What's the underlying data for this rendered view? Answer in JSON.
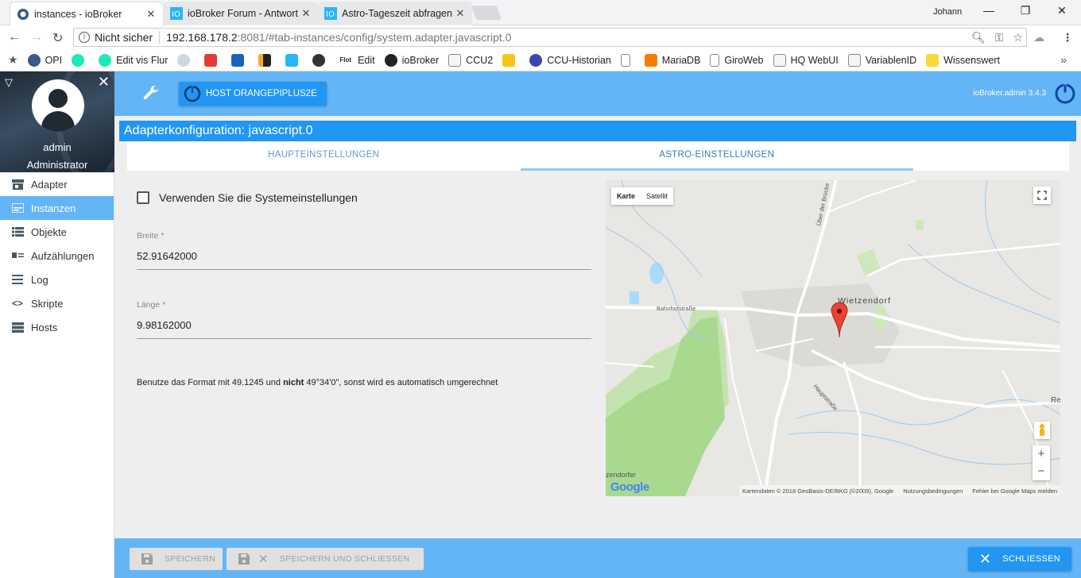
{
  "browser": {
    "tabs": [
      {
        "title": "instances - ioBroker",
        "active": true
      },
      {
        "title": "ioBroker Forum - Antwort",
        "active": false
      },
      {
        "title": "Astro-Tageszeit abfragen",
        "active": false
      }
    ],
    "profile_name": "Johann",
    "address": {
      "security": "Nicht sicher",
      "host": "192.168.178.2",
      "path": ":8081/#tab-instances/config/system.adapter.javascript.0"
    },
    "bookmarks": [
      {
        "label": "",
        "color": "#3a5a8a"
      },
      {
        "label": "OPI",
        "color": "#3a5a8a"
      },
      {
        "label": "",
        "color": "#1de9b6"
      },
      {
        "label": "Edit vis Flur",
        "color": "#1de9b6"
      },
      {
        "label": "",
        "color": "#b0bec5"
      },
      {
        "label": "",
        "color": "#e53935"
      },
      {
        "label": "",
        "color": "#1565c0"
      },
      {
        "label": "",
        "color": "#f9a825"
      },
      {
        "label": "",
        "color": "#29b6f6"
      },
      {
        "label": "",
        "color": "#333333"
      },
      {
        "label": "Edit",
        "color": "#ffffff"
      },
      {
        "label": "ioBroker",
        "color": "#222222"
      },
      {
        "label": "CCU2",
        "color": "#eeeeee"
      },
      {
        "label": "",
        "color": "#f5c518"
      },
      {
        "label": "CCU-Historian",
        "color": "#3949ab"
      },
      {
        "label": "",
        "color": "#eeeeee"
      },
      {
        "label": "MariaDB",
        "color": "#f57c00"
      },
      {
        "label": "GiroWeb",
        "color": "#eeeeee"
      },
      {
        "label": "HQ WebUI",
        "color": "#eeeeee"
      },
      {
        "label": "VariablenID",
        "color": "#eeeeee"
      },
      {
        "label": "Wissenswert",
        "color": "#fdd835"
      }
    ],
    "flot_label": "Flot"
  },
  "sidebar": {
    "user": "admin",
    "role": "Administrator",
    "items": [
      {
        "label": "Adapter",
        "icon": "store-icon",
        "active": false
      },
      {
        "label": "Instanzen",
        "icon": "instances-icon",
        "active": true
      },
      {
        "label": "Objekte",
        "icon": "list-icon",
        "active": false
      },
      {
        "label": "Aufzählungen",
        "icon": "enums-icon",
        "active": false
      },
      {
        "label": "Log",
        "icon": "log-icon",
        "active": false
      },
      {
        "label": "Skripte",
        "icon": "code-icon",
        "active": false
      },
      {
        "label": "Hosts",
        "icon": "hosts-icon",
        "active": false
      }
    ]
  },
  "appbar": {
    "host_button": "HOST ORANGEPIPLUS2E",
    "version": "ioBroker.admin 3.4.3"
  },
  "main": {
    "title": "Adapterkonfiguration: javascript.0",
    "tabs": [
      {
        "label": "HAUPTEINSTELLUNGEN",
        "selected": false
      },
      {
        "label": "ASTRO-EINSTELLUNGEN",
        "selected": true
      }
    ],
    "checkbox_label": "Verwenden Sie die Systemeinstellungen",
    "checkbox_checked": false,
    "latitude": {
      "label": "Breite *",
      "value": "52.91642000"
    },
    "longitude": {
      "label": "Länge *",
      "value": "9.98162000"
    },
    "hint": {
      "prefix": "Benutze das Format mit 49.1245 und ",
      "bold": "nicht",
      "suffix": " 49°34'0\", sonst wird es automatisch umgerechnet"
    }
  },
  "map": {
    "type_map": "Karte",
    "type_satellite": "Satellit",
    "town": "Wietzendorf",
    "street_1": "Bahnhofstraße",
    "street_2": "Hauptstraße",
    "street_3": "Über der Brücke",
    "edge_label_right": "Re",
    "edge_label_left": "zendorfer",
    "google": "Google",
    "zoom_in": "+",
    "zoom_out": "−",
    "attribution": "Kartendaten © 2018 GeoBasis-DE/BKG (©2009), Google",
    "terms": "Nutzungsbedingungen",
    "report": "Fehler bei Google Maps melden"
  },
  "bottom": {
    "save": "SPEICHERN",
    "save_close": "SPEICHERN UND SCHLIESSEN",
    "close": "SCHLIESSEN"
  },
  "colors": {
    "accent": "#2196f3",
    "bar": "#64b5f6",
    "sidebar_active": "#64b5f6"
  }
}
